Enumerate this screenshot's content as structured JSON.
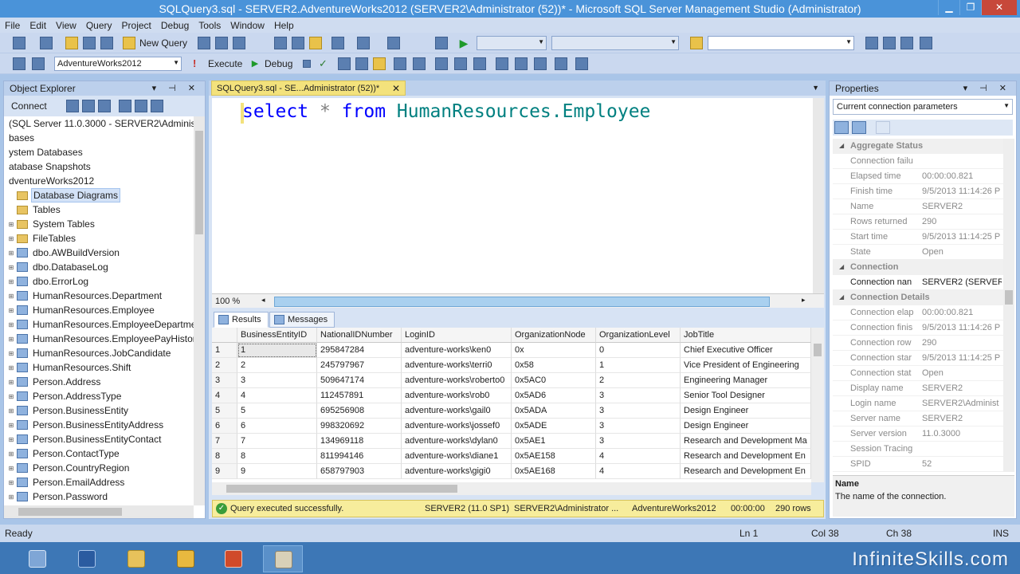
{
  "window": {
    "title": "SQLQuery3.sql - SERVER2.AdventureWorks2012 (SERVER2\\Administrator (52))* - Microsoft SQL Server Management Studio (Administrator)",
    "minimize": "▁",
    "restore": "❐",
    "close": "✕"
  },
  "menu": [
    "File",
    "Edit",
    "View",
    "Query",
    "Project",
    "Debug",
    "Tools",
    "Window",
    "Help"
  ],
  "toolbar1": {
    "new_query": "New Query"
  },
  "toolbar2": {
    "database": "AdventureWorks2012",
    "execute": "Execute",
    "debug": "Debug"
  },
  "object_explorer": {
    "title": "Object Explorer",
    "connect": "Connect",
    "tree": [
      {
        "label": "(SQL Server 11.0.3000 - SERVER2\\Administr",
        "indent": 0,
        "icon": "none",
        "expander": ""
      },
      {
        "label": "bases",
        "indent": 0,
        "icon": "none",
        "expander": ""
      },
      {
        "label": "ystem Databases",
        "indent": 0,
        "icon": "none",
        "expander": ""
      },
      {
        "label": "atabase Snapshots",
        "indent": 0,
        "icon": "none",
        "expander": ""
      },
      {
        "label": "dventureWorks2012",
        "indent": 0,
        "icon": "none",
        "expander": ""
      },
      {
        "label": "Database Diagrams",
        "indent": 0,
        "icon": "folder",
        "expander": "",
        "selected": true
      },
      {
        "label": "Tables",
        "indent": 0,
        "icon": "folder",
        "expander": ""
      },
      {
        "label": "System Tables",
        "indent": 1,
        "icon": "folder",
        "expander": "+"
      },
      {
        "label": "FileTables",
        "indent": 1,
        "icon": "folder",
        "expander": "+"
      },
      {
        "label": "dbo.AWBuildVersion",
        "indent": 1,
        "icon": "table",
        "expander": "+"
      },
      {
        "label": "dbo.DatabaseLog",
        "indent": 1,
        "icon": "table",
        "expander": "+"
      },
      {
        "label": "dbo.ErrorLog",
        "indent": 1,
        "icon": "table",
        "expander": "+"
      },
      {
        "label": "HumanResources.Department",
        "indent": 1,
        "icon": "table",
        "expander": "+"
      },
      {
        "label": "HumanResources.Employee",
        "indent": 1,
        "icon": "table",
        "expander": "+"
      },
      {
        "label": "HumanResources.EmployeeDepartme",
        "indent": 1,
        "icon": "table",
        "expander": "+"
      },
      {
        "label": "HumanResources.EmployeePayHistor",
        "indent": 1,
        "icon": "table",
        "expander": "+"
      },
      {
        "label": "HumanResources.JobCandidate",
        "indent": 1,
        "icon": "table",
        "expander": "+"
      },
      {
        "label": "HumanResources.Shift",
        "indent": 1,
        "icon": "table",
        "expander": "+"
      },
      {
        "label": "Person.Address",
        "indent": 1,
        "icon": "table",
        "expander": "+"
      },
      {
        "label": "Person.AddressType",
        "indent": 1,
        "icon": "table",
        "expander": "+"
      },
      {
        "label": "Person.BusinessEntity",
        "indent": 1,
        "icon": "table",
        "expander": "+"
      },
      {
        "label": "Person.BusinessEntityAddress",
        "indent": 1,
        "icon": "table",
        "expander": "+"
      },
      {
        "label": "Person.BusinessEntityContact",
        "indent": 1,
        "icon": "table",
        "expander": "+"
      },
      {
        "label": "Person.ContactType",
        "indent": 1,
        "icon": "table",
        "expander": "+"
      },
      {
        "label": "Person.CountryRegion",
        "indent": 1,
        "icon": "table",
        "expander": "+"
      },
      {
        "label": "Person.EmailAddress",
        "indent": 1,
        "icon": "table",
        "expander": "+"
      },
      {
        "label": "Person.Password",
        "indent": 1,
        "icon": "table",
        "expander": "+"
      }
    ]
  },
  "editor": {
    "tab_label": "SQLQuery3.sql - SE...Administrator (52))*",
    "tab_close": "✕",
    "code": {
      "kw1": "select",
      "star": "*",
      "kw2": "from",
      "object": "HumanResources.Employee"
    },
    "zoom": "100 %"
  },
  "results": {
    "tabs": [
      "Results",
      "Messages"
    ],
    "columns": [
      "",
      "BusinessEntityID",
      "NationalIDNumber",
      "LoginID",
      "OrganizationNode",
      "OrganizationLevel",
      "JobTitle"
    ],
    "rows": [
      [
        "1",
        "1",
        "295847284",
        "adventure-works\\ken0",
        "0x",
        "0",
        "Chief Executive Officer"
      ],
      [
        "2",
        "2",
        "245797967",
        "adventure-works\\terri0",
        "0x58",
        "1",
        "Vice President of Engineering"
      ],
      [
        "3",
        "3",
        "509647174",
        "adventure-works\\roberto0",
        "0x5AC0",
        "2",
        "Engineering Manager"
      ],
      [
        "4",
        "4",
        "112457891",
        "adventure-works\\rob0",
        "0x5AD6",
        "3",
        "Senior Tool Designer"
      ],
      [
        "5",
        "5",
        "695256908",
        "adventure-works\\gail0",
        "0x5ADA",
        "3",
        "Design Engineer"
      ],
      [
        "6",
        "6",
        "998320692",
        "adventure-works\\jossef0",
        "0x5ADE",
        "3",
        "Design Engineer"
      ],
      [
        "7",
        "7",
        "134969118",
        "adventure-works\\dylan0",
        "0x5AE1",
        "3",
        "Research and Development Ma"
      ],
      [
        "8",
        "8",
        "811994146",
        "adventure-works\\diane1",
        "0x5AE158",
        "4",
        "Research and Development En"
      ],
      [
        "9",
        "9",
        "658797903",
        "adventure-works\\gigi0",
        "0x5AE168",
        "4",
        "Research and Development En"
      ]
    ]
  },
  "query_status": {
    "message": "Query executed successfully.",
    "server": "SERVER2 (11.0 SP1)",
    "user": "SERVER2\\Administrator ...",
    "database": "AdventureWorks2012",
    "elapsed": "00:00:00",
    "rows": "290 rows"
  },
  "properties": {
    "title": "Properties",
    "selector": "Current connection parameters",
    "rows": [
      {
        "type": "cat",
        "name": "Aggregate Status"
      },
      {
        "type": "prop",
        "name": "Connection failu",
        "value": ""
      },
      {
        "type": "prop",
        "name": "Elapsed time",
        "value": "00:00:00.821"
      },
      {
        "type": "prop",
        "name": "Finish time",
        "value": "9/5/2013 11:14:26 P"
      },
      {
        "type": "prop",
        "name": "Name",
        "value": "SERVER2"
      },
      {
        "type": "prop",
        "name": "Rows returned",
        "value": "290"
      },
      {
        "type": "prop",
        "name": "Start time",
        "value": "9/5/2013 11:14:25 P"
      },
      {
        "type": "prop",
        "name": "State",
        "value": "Open"
      },
      {
        "type": "cat",
        "name": "Connection"
      },
      {
        "type": "prop",
        "name": "Connection nan",
        "value": "SERVER2 (SERVER2",
        "dark": true
      },
      {
        "type": "cat",
        "name": "Connection Details"
      },
      {
        "type": "prop",
        "name": "Connection elap",
        "value": "00:00:00.821"
      },
      {
        "type": "prop",
        "name": "Connection finis",
        "value": "9/5/2013 11:14:26 P"
      },
      {
        "type": "prop",
        "name": "Connection row",
        "value": "290"
      },
      {
        "type": "prop",
        "name": "Connection star",
        "value": "9/5/2013 11:14:25 P"
      },
      {
        "type": "prop",
        "name": "Connection stat",
        "value": "Open"
      },
      {
        "type": "prop",
        "name": "Display name",
        "value": "SERVER2"
      },
      {
        "type": "prop",
        "name": "Login name",
        "value": "SERVER2\\Administ"
      },
      {
        "type": "prop",
        "name": "Server name",
        "value": "SERVER2"
      },
      {
        "type": "prop",
        "name": "Server version",
        "value": "11.0.3000"
      },
      {
        "type": "prop",
        "name": "Session Tracing",
        "value": ""
      },
      {
        "type": "prop",
        "name": "SPID",
        "value": "52"
      }
    ],
    "desc_title": "Name",
    "desc_text": "The name of the connection."
  },
  "statusbar": {
    "ready": "Ready",
    "ln": "Ln 1",
    "col": "Col 38",
    "ch": "Ch 38",
    "ins": "INS"
  },
  "brand": "InfiniteSkills.com"
}
